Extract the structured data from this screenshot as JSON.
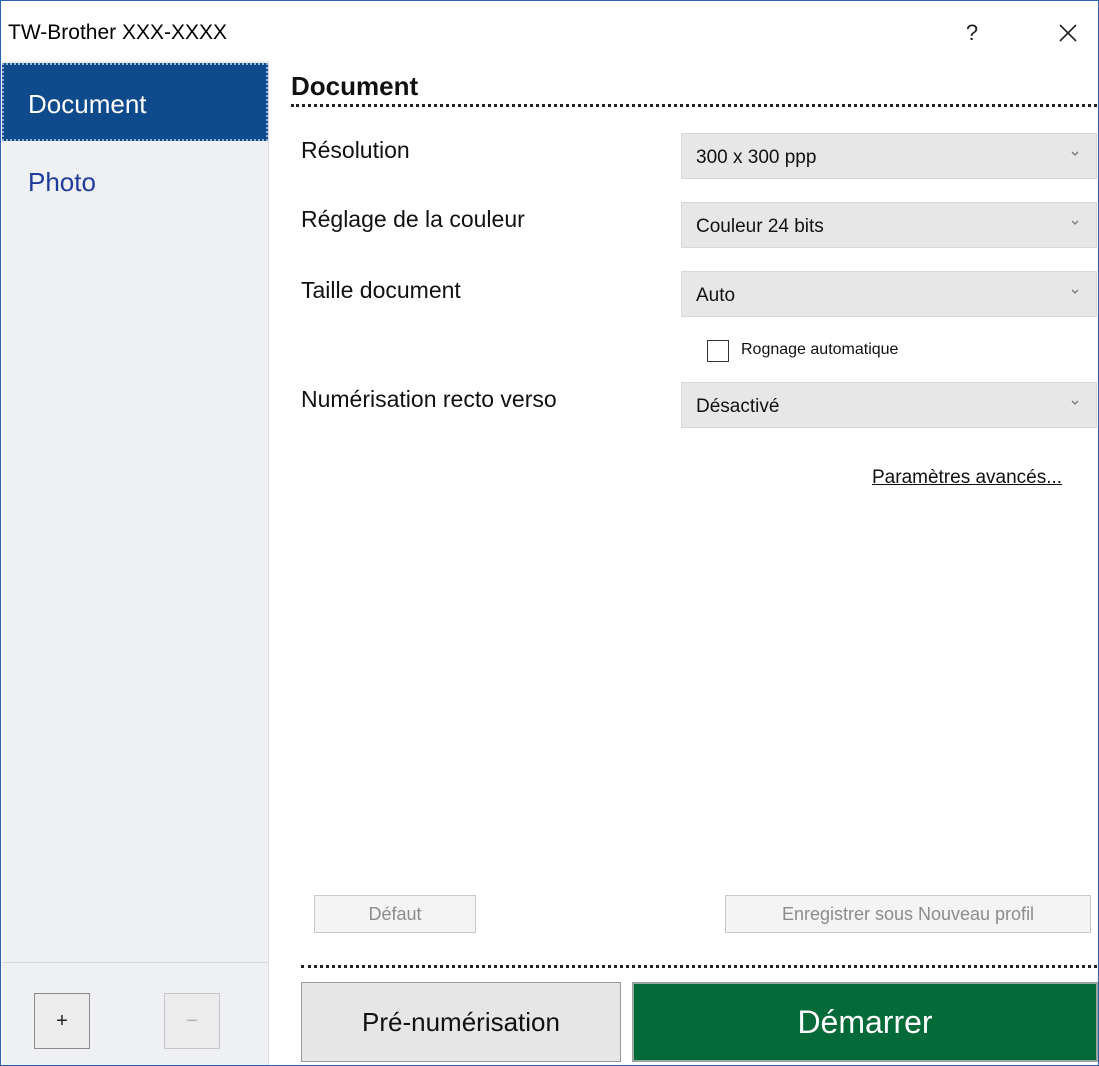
{
  "window": {
    "title": "TW-Brother XXX-XXXX",
    "help": "?"
  },
  "sidebar": {
    "items": [
      {
        "label": "Document",
        "selected": true
      },
      {
        "label": "Photo",
        "selected": false
      }
    ],
    "add_label": "+",
    "remove_label": "−"
  },
  "main": {
    "section_title": "Document",
    "fields": [
      {
        "label": "Résolution",
        "value": "300 x 300 ppp"
      },
      {
        "label": "Réglage de la couleur",
        "value": "Couleur 24 bits"
      },
      {
        "label": "Taille document",
        "value": "Auto"
      },
      {
        "label": "Numérisation recto verso",
        "value": "Désactivé"
      }
    ],
    "auto_crop": {
      "label": "Rognage automatique",
      "checked": false
    },
    "advanced_link": "Paramètres avancés...",
    "default_button": "Défaut",
    "save_profile_button": "Enregistrer sous Nouveau profil",
    "prescan_button": "Pré-numérisation",
    "start_button": "Démarrer"
  },
  "colors": {
    "accent_blue": "#0f4a8c",
    "start_green": "#046a38",
    "sidebar_bg": "#eef0f3"
  }
}
